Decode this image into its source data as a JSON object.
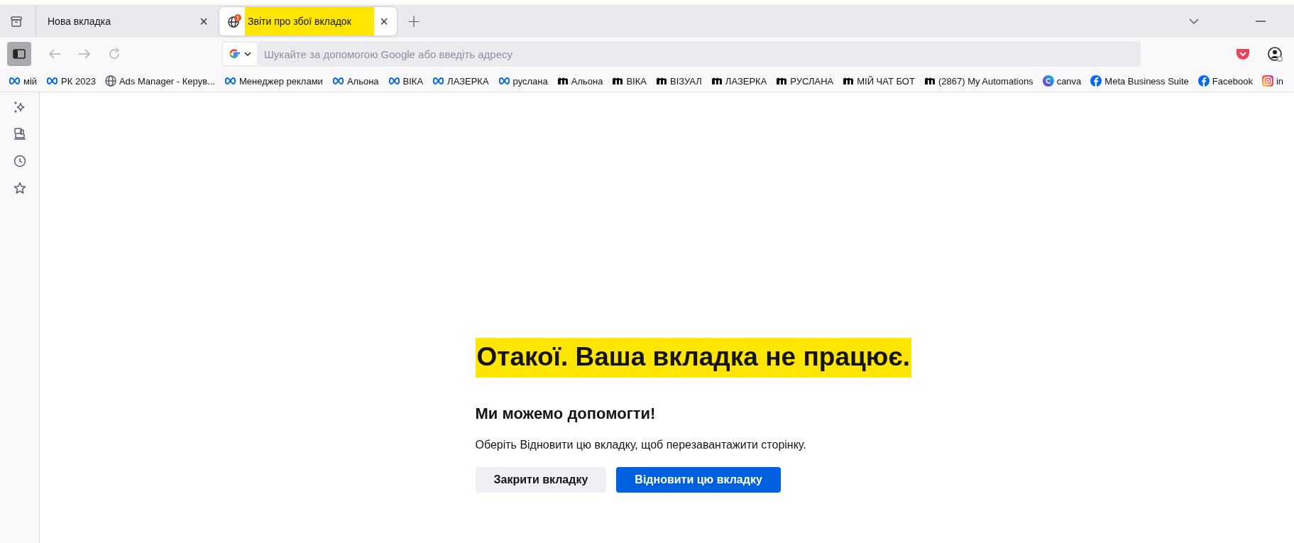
{
  "tabs": [
    {
      "title": "Нова вкладка",
      "selected": false,
      "kind": "plain",
      "highlighted": false,
      "close": "×"
    },
    {
      "title": "Звіти про збої вкладок",
      "selected": true,
      "kind": "crashed",
      "highlighted": true,
      "close": "×"
    }
  ],
  "new_tab": "+",
  "address_bar": {
    "placeholder": "Шукайте за допомогою Google або введіть адресу"
  },
  "bookmarks": [
    {
      "label": "мій"
    },
    {
      "label": "РК 2023"
    },
    {
      "label": "Ads Manager - Керув..."
    },
    {
      "label": "Менеджер реклами"
    },
    {
      "label": "Альона"
    },
    {
      "label": "ВІКА"
    },
    {
      "label": "ЛАЗЕРКА"
    },
    {
      "label": "руслана"
    },
    {
      "label": "Альона"
    },
    {
      "label": "ВІКА"
    },
    {
      "label": "ВІЗУАЛ"
    },
    {
      "label": "ЛАЗЕРКА"
    },
    {
      "label": "РУСЛАНА"
    },
    {
      "label": "МІЙ ЧАТ БОТ"
    },
    {
      "label": "(2867) My Automations"
    },
    {
      "label": "canva"
    },
    {
      "label": "Meta Business Suite"
    },
    {
      "label": "Facebook"
    },
    {
      "label": "in"
    }
  ],
  "error_page": {
    "title": "Отакої. Ваша вкладка не працює.",
    "title_highlighted": true,
    "subtitle": "Ми можемо допомогти!",
    "message": "Оберіть Відновити цю вкладку, щоб перезавантажити сторінку.",
    "buttons": [
      {
        "label": "Закрити вкладку",
        "kind": "secondary"
      },
      {
        "label": "Відновити цю вкладку",
        "kind": "primary"
      }
    ]
  }
}
